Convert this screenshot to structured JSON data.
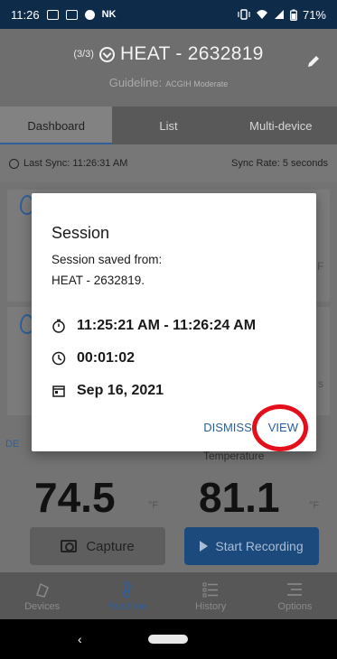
{
  "status_bar": {
    "time": "11:26",
    "icons_left": [
      "chat-icon",
      "news-icon",
      "circle-icon",
      "nk-icon"
    ],
    "icons_right": [
      "vibrate-icon",
      "wifi-icon",
      "signal-icon",
      "battery-icon"
    ],
    "battery": "71%",
    "nk_text": "NK"
  },
  "header": {
    "count": "(3/3)",
    "title": "HEAT - 2632819",
    "guideline_label": "Guideline:",
    "guideline_value": "ACGIH Moderate"
  },
  "tabs": [
    {
      "label": "Dashboard",
      "active": true
    },
    {
      "label": "List",
      "active": false
    },
    {
      "label": "Multi-device",
      "active": false
    }
  ],
  "sync": {
    "last_sync": "Last Sync: 11:26:31 AM",
    "rate": "Sync Rate: 5 seconds"
  },
  "cards": {
    "peek_unit_1": "F",
    "peek_unit_2": "s",
    "dew_label": "DE",
    "temp_label": "Temperature",
    "dew_value": "74.5",
    "temp_value": "81.1",
    "unit": "°F"
  },
  "actions": {
    "capture": "Capture",
    "start_recording": "Start Recording"
  },
  "bottom_nav": [
    {
      "label": "Devices",
      "icon": "devices-icon",
      "active": false
    },
    {
      "label": "Realtime",
      "icon": "thermometer-icon",
      "active": true
    },
    {
      "label": "History",
      "icon": "list-icon",
      "active": false
    },
    {
      "label": "Options",
      "icon": "options-icon",
      "active": false
    }
  ],
  "dialog": {
    "title": "Session",
    "message_line1": "Session saved from:",
    "message_line2": "HEAT - 2632819.",
    "time_range": "11:25:21 AM - 11:26:24 AM",
    "duration": "00:01:02",
    "date": "Sep 16, 2021",
    "dismiss": "DISMISS",
    "view": "VIEW"
  },
  "colors": {
    "accent": "#2a5e9a",
    "status_bar": "#0f2b4a",
    "highlight": "#e3101b"
  }
}
